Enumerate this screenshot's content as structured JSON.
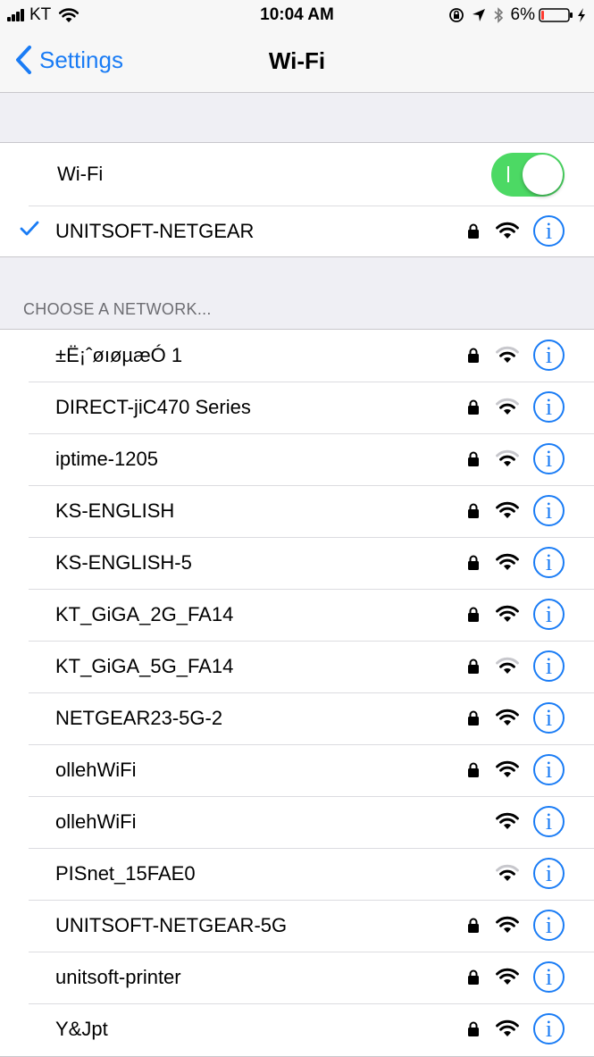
{
  "status": {
    "carrier": "KT",
    "time": "10:04 AM",
    "battery": "6%",
    "icons": [
      "signal-bars-icon",
      "wifi-icon",
      "orientation-lock-icon",
      "location-arrow-icon",
      "bluetooth-icon",
      "battery-icon",
      "charging-bolt-icon"
    ]
  },
  "nav": {
    "back_label": "Settings",
    "title": "Wi-Fi"
  },
  "wifi": {
    "toggle_label": "Wi-Fi",
    "enabled": true,
    "connected": {
      "name": "UNITSOFT-NETGEAR",
      "secure": true,
      "strength": "strong"
    }
  },
  "section_header": "CHOOSE A NETWORK...",
  "networks": [
    {
      "name": "±Ë¡ˆøıøµæÓ 1",
      "secure": true,
      "strength": "weak"
    },
    {
      "name": "DIRECT-jiC470 Series",
      "secure": true,
      "strength": "weak"
    },
    {
      "name": "iptime-1205",
      "secure": true,
      "strength": "weak"
    },
    {
      "name": "KS-ENGLISH",
      "secure": true,
      "strength": "strong"
    },
    {
      "name": "KS-ENGLISH-5",
      "secure": true,
      "strength": "strong"
    },
    {
      "name": "KT_GiGA_2G_FA14",
      "secure": true,
      "strength": "strong"
    },
    {
      "name": "KT_GiGA_5G_FA14",
      "secure": true,
      "strength": "weak"
    },
    {
      "name": "NETGEAR23-5G-2",
      "secure": true,
      "strength": "strong"
    },
    {
      "name": "ollehWiFi",
      "secure": true,
      "strength": "strong"
    },
    {
      "name": "ollehWiFi",
      "secure": false,
      "strength": "strong"
    },
    {
      "name": "PISnet_15FAE0",
      "secure": false,
      "strength": "weak"
    },
    {
      "name": "UNITSOFT-NETGEAR-5G",
      "secure": true,
      "strength": "strong"
    },
    {
      "name": "unitsoft-printer",
      "secure": true,
      "strength": "strong"
    },
    {
      "name": "Y&Jpt",
      "secure": true,
      "strength": "strong"
    }
  ],
  "info_glyph": "i",
  "colors": {
    "accent": "#1a7cf5",
    "toggle_on": "#4cd964",
    "battery_low": "#ff3b30"
  }
}
